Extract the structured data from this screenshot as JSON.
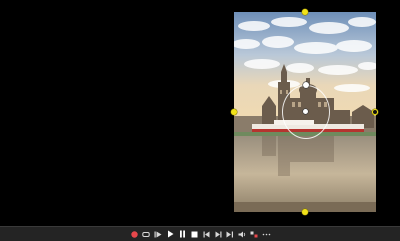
{
  "viewer": {
    "image_subject": "dresden-cathedral-riverside-photo"
  },
  "toolbar": {
    "buttons": [
      {
        "name": "record-button",
        "icon": "record-icon"
      },
      {
        "name": "loop-button",
        "icon": "loop-icon"
      },
      {
        "name": "step-back-button",
        "icon": "step-back-icon"
      },
      {
        "name": "play-button",
        "icon": "play-icon"
      },
      {
        "name": "pause-button",
        "icon": "pause-icon"
      },
      {
        "name": "stop-button",
        "icon": "stop-icon"
      },
      {
        "name": "skip-previous-button",
        "icon": "skip-previous-icon"
      },
      {
        "name": "skip-next-button",
        "icon": "skip-next-icon"
      },
      {
        "name": "frame-advance-button",
        "icon": "frame-advance-icon"
      },
      {
        "name": "volume-button",
        "icon": "volume-icon"
      },
      {
        "name": "settings-button",
        "icon": "settings-icon"
      },
      {
        "name": "more-button",
        "icon": "more-icon"
      }
    ]
  },
  "colors": {
    "handle": "#f1e21a",
    "record": "#e8474b",
    "toolbar_bg": "#242424",
    "icon": "#d8d8d8"
  }
}
